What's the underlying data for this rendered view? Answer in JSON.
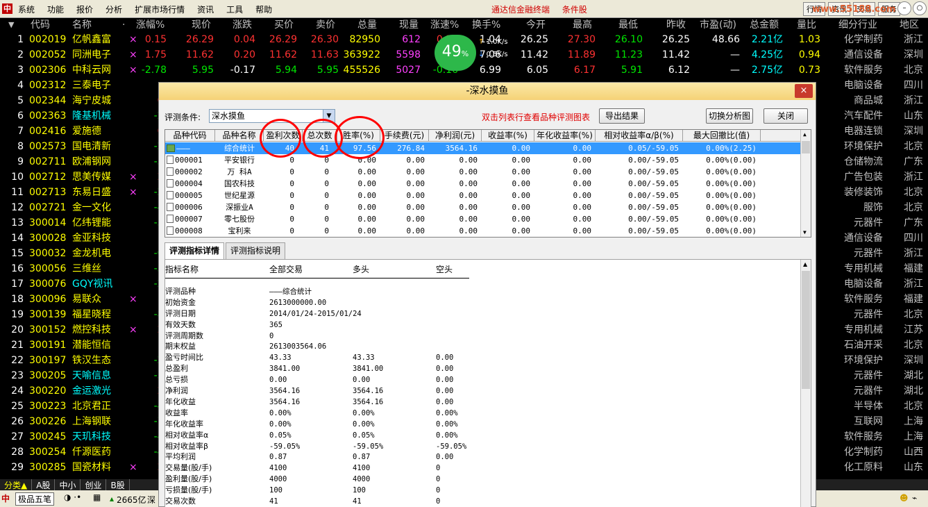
{
  "menubar": {
    "logo": "中",
    "menus": [
      "系统",
      "功能",
      "报价",
      "分析",
      "扩展市场行情",
      "资讯",
      "工具",
      "帮助"
    ],
    "center_links": [
      "通达信金融终端",
      "条件股"
    ],
    "right_buttons": [
      "行情",
      "资讯",
      "交易",
      "服务"
    ],
    "watermark": "www.55188.com"
  },
  "table": {
    "headers": [
      "代码",
      "名称",
      "·",
      "涨幅%",
      "现价",
      "涨跌",
      "买价",
      "卖价",
      "总量",
      "现量",
      "涨速%",
      "换手%",
      "今开",
      "最高",
      "最低",
      "昨收",
      "市盈(动)",
      "总金额",
      "量比",
      "细分行业",
      "地区"
    ],
    "rows": [
      {
        "n": "1",
        "code": "002019",
        "name": "亿帆鑫富",
        "mark": "×",
        "pct": "0.15",
        "price": "26.29",
        "chg": "0.04",
        "bid": "26.29",
        "ask": "26.30",
        "vol": "82950",
        "cur": "612",
        "spd": "0.11",
        "turn": "1.04",
        "open": "26.25",
        "high": "27.30",
        "low": "26.10",
        "prev": "26.25",
        "pe": "48.66",
        "amt": "2.21亿",
        "ratio": "1.03",
        "ind": "化学制药",
        "area": "浙江",
        "nc": "yellow",
        "dir": "up"
      },
      {
        "n": "2",
        "code": "002052",
        "name": "同洲电子",
        "mark": "×",
        "pct": "1.75",
        "price": "11.62",
        "chg": "0.20",
        "bid": "11.62",
        "ask": "11.63",
        "vol": "363922",
        "cur": "5598",
        "spd": "0.09",
        "turn": "7.06",
        "open": "11.42",
        "high": "11.89",
        "low": "11.23",
        "prev": "11.42",
        "pe": "—",
        "amt": "4.25亿",
        "ratio": "0.94",
        "ind": "通信设备",
        "area": "深圳",
        "nc": "yellow",
        "dir": "up"
      },
      {
        "n": "3",
        "code": "002306",
        "name": "中科云网",
        "mark": "×",
        "pct": "-2.78",
        "price": "5.95",
        "chg": "-0.17",
        "bid": "5.94",
        "ask": "5.95",
        "vol": "455526",
        "cur": "5027",
        "spd": "-0.16",
        "turn": "6.99",
        "open": "6.05",
        "high": "6.17",
        "low": "5.91",
        "prev": "6.12",
        "pe": "—",
        "amt": "2.75亿",
        "ratio": "0.73",
        "ind": "软件服务",
        "area": "北京",
        "nc": "yellow",
        "dir": "down"
      },
      {
        "n": "4",
        "code": "002312",
        "name": "三泰电子",
        "ind": "电脑设备",
        "area": "四川",
        "nc": "yellow",
        "dir": "none"
      },
      {
        "n": "5",
        "code": "002344",
        "name": "海宁皮城",
        "pct": "0.",
        "ind": "商品城",
        "area": "浙江",
        "nc": "yellow",
        "dir": "up"
      },
      {
        "n": "6",
        "code": "002363",
        "name": "隆基机械",
        "pct": "-2.",
        "ind": "汽车配件",
        "area": "山东",
        "nc": "cyan",
        "dir": "down"
      },
      {
        "n": "7",
        "code": "002416",
        "name": "爱施德",
        "pct": "0.",
        "ind": "电器连锁",
        "area": "深圳",
        "nc": "yellow",
        "dir": "up"
      },
      {
        "n": "8",
        "code": "002573",
        "name": "国电清新",
        "pct": "-2.",
        "ind": "环境保护",
        "area": "北京",
        "nc": "yellow",
        "dir": "down"
      },
      {
        "n": "9",
        "code": "002711",
        "name": "欧浦钢网",
        "pct": "-5.",
        "ind": "仓储物流",
        "area": "广东",
        "nc": "yellow",
        "dir": "down"
      },
      {
        "n": "10",
        "code": "002712",
        "name": "思美传媒",
        "mark": "×",
        "pct": "2.",
        "ind": "广告包装",
        "area": "浙江",
        "nc": "yellow",
        "dir": "up"
      },
      {
        "n": "11",
        "code": "002713",
        "name": "东易日盛",
        "mark": "×",
        "pct": "-2.",
        "ind": "装修装饰",
        "area": "北京",
        "nc": "yellow",
        "dir": "down"
      },
      {
        "n": "12",
        "code": "002721",
        "name": "金一文化",
        "pct": "-4.",
        "ind": "服饰",
        "area": "北京",
        "nc": "yellow",
        "dir": "down"
      },
      {
        "n": "13",
        "code": "300014",
        "name": "亿纬锂能",
        "pct": "-3.",
        "ind": "元器件",
        "area": "广东",
        "nc": "yellow",
        "dir": "down"
      },
      {
        "n": "14",
        "code": "300028",
        "name": "金亚科技",
        "ind": "通信设备",
        "area": "四川",
        "nc": "yellow",
        "dir": "none"
      },
      {
        "n": "15",
        "code": "300032",
        "name": "金龙机电",
        "pct": "-0.",
        "ind": "元器件",
        "area": "浙江",
        "nc": "yellow",
        "dir": "down"
      },
      {
        "n": "16",
        "code": "300056",
        "name": "三维丝",
        "pct": "-5.",
        "ind": "专用机械",
        "area": "福建",
        "nc": "yellow",
        "dir": "down"
      },
      {
        "n": "17",
        "code": "300076",
        "name": "GQY视讯",
        "pct": "-2.",
        "ind": "电脑设备",
        "area": "浙江",
        "nc": "cyan",
        "dir": "down"
      },
      {
        "n": "18",
        "code": "300096",
        "name": "易联众",
        "mark": "×",
        "pct": "1.",
        "ind": "软件服务",
        "area": "福建",
        "nc": "yellow",
        "dir": "up"
      },
      {
        "n": "19",
        "code": "300139",
        "name": "福星晓程",
        "pct": "-8.",
        "ind": "元器件",
        "area": "北京",
        "nc": "yellow",
        "dir": "down"
      },
      {
        "n": "20",
        "code": "300152",
        "name": "燃控科技",
        "mark": "×",
        "pct": "2.",
        "ind": "专用机械",
        "area": "江苏",
        "nc": "yellow",
        "dir": "up"
      },
      {
        "n": "21",
        "code": "300191",
        "name": "潜能恒信",
        "pct": "1.",
        "ind": "石油开采",
        "area": "北京",
        "nc": "yellow",
        "dir": "up"
      },
      {
        "n": "22",
        "code": "300197",
        "name": "铁汉生态",
        "pct": "-2.",
        "ind": "环境保护",
        "area": "深圳",
        "nc": "yellow",
        "dir": "down"
      },
      {
        "n": "23",
        "code": "300205",
        "name": "天喻信息",
        "pct": "-3.",
        "ind": "元器件",
        "area": "湖北",
        "nc": "cyan",
        "dir": "down"
      },
      {
        "n": "24",
        "code": "300220",
        "name": "金运激光",
        "pct": "2.",
        "ind": "元器件",
        "area": "湖北",
        "nc": "cyan",
        "dir": "up"
      },
      {
        "n": "25",
        "code": "300223",
        "name": "北京君正",
        "pct": "-4.",
        "ind": "半导体",
        "area": "北京",
        "nc": "yellow",
        "dir": "down"
      },
      {
        "n": "26",
        "code": "300226",
        "name": "上海钢联",
        "pct": "-7.",
        "ind": "互联网",
        "area": "上海",
        "nc": "yellow",
        "dir": "down"
      },
      {
        "n": "27",
        "code": "300245",
        "name": "天玑科技",
        "pct": "-4.",
        "ind": "软件服务",
        "area": "上海",
        "nc": "cyan",
        "dir": "down"
      },
      {
        "n": "28",
        "code": "300254",
        "name": "仟源医药",
        "pct": "-4.",
        "ind": "化学制药",
        "area": "山西",
        "nc": "yellow",
        "dir": "down"
      },
      {
        "n": "29",
        "code": "300285",
        "name": "国瓷材料",
        "mark": "×",
        "pct": "2.",
        "ind": "化工原料",
        "area": "山东",
        "nc": "yellow",
        "dir": "up"
      }
    ]
  },
  "speed_widget": {
    "value": "49",
    "unit": "%",
    "up": "1.0K/s",
    "down": "0.5K/s"
  },
  "bottom_tabs": [
    "分类▲",
    "A股",
    "中小",
    "创业",
    "B股"
  ],
  "statusbar": {
    "ime": "极品五笔",
    "amount": "2665亿",
    "market": "深"
  },
  "dialog": {
    "title": "-深水摸鱼",
    "close": "×",
    "condition_label": "评测条件:",
    "condition_value": "深水摸鱼",
    "hint": "双击列表行查看品种评测图表",
    "export_button": "导出结果",
    "switch_button": "切换分析图",
    "close_button": "关闭",
    "grid_headers": [
      "品种代码",
      "品种名称",
      "盈利次数",
      "总次数",
      "胜率(%)",
      "手续费(元)",
      "净利润(元)",
      "收益率(%)",
      "年化收益率(%)",
      "相对收益率α/β(%)",
      "最大回撤比(值)"
    ],
    "grid_rows": [
      {
        "code": "———",
        "name": "综合统计",
        "win": "40",
        "total": "41",
        "rate": "97.56",
        "fee": "276.84",
        "profit": "3564.16",
        "ret": "0.00",
        "annual": "0.00",
        "rel": "0.05/-59.05",
        "dd": "0.00%(2.25)",
        "sel": true
      },
      {
        "code": "000001",
        "name": "平安银行",
        "win": "0",
        "total": "0",
        "rate": "0.00",
        "fee": "0.00",
        "profit": "0.00",
        "ret": "0.00",
        "annual": "0.00",
        "rel": "0.00/-59.05",
        "dd": "0.00%(0.00)"
      },
      {
        "code": "000002",
        "name": "万 科A",
        "win": "0",
        "total": "0",
        "rate": "0.00",
        "fee": "0.00",
        "profit": "0.00",
        "ret": "0.00",
        "annual": "0.00",
        "rel": "0.00/-59.05",
        "dd": "0.00%(0.00)"
      },
      {
        "code": "000004",
        "name": "国农科技",
        "win": "0",
        "total": "0",
        "rate": "0.00",
        "fee": "0.00",
        "profit": "0.00",
        "ret": "0.00",
        "annual": "0.00",
        "rel": "0.00/-59.05",
        "dd": "0.00%(0.00)"
      },
      {
        "code": "000005",
        "name": "世纪星源",
        "win": "0",
        "total": "0",
        "rate": "0.00",
        "fee": "0.00",
        "profit": "0.00",
        "ret": "0.00",
        "annual": "0.00",
        "rel": "0.00/-59.05",
        "dd": "0.00%(0.00)"
      },
      {
        "code": "000006",
        "name": "深振业A",
        "win": "0",
        "total": "0",
        "rate": "0.00",
        "fee": "0.00",
        "profit": "0.00",
        "ret": "0.00",
        "annual": "0.00",
        "rel": "0.00/-59.05",
        "dd": "0.00%(0.00)"
      },
      {
        "code": "000007",
        "name": "零七股份",
        "win": "0",
        "total": "0",
        "rate": "0.00",
        "fee": "0.00",
        "profit": "0.00",
        "ret": "0.00",
        "annual": "0.00",
        "rel": "0.00/-59.05",
        "dd": "0.00%(0.00)"
      },
      {
        "code": "000008",
        "name": "宝利来",
        "win": "0",
        "total": "0",
        "rate": "0.00",
        "fee": "0.00",
        "profit": "0.00",
        "ret": "0.00",
        "annual": "0.00",
        "rel": "0.00/-59.05",
        "dd": "0.00%(0.00)"
      }
    ],
    "tabs": [
      "评测指标详情",
      "评测指标说明"
    ],
    "detail_headers": [
      "指标名称",
      "全部交易",
      "多头",
      "空头"
    ],
    "detail_rows": [
      {
        "label": "",
        "all": "",
        "long": "",
        "short": ""
      },
      {
        "label": "评测品种",
        "all": "———综合统计",
        "long": "",
        "short": ""
      },
      {
        "label": "初始资金",
        "all": "2613000000.00",
        "long": "",
        "short": ""
      },
      {
        "label": "评测日期",
        "all": "2014/01/24-2015/01/24",
        "long": "",
        "short": ""
      },
      {
        "label": "有效天数",
        "all": "365",
        "long": "",
        "short": ""
      },
      {
        "label": "评测周期数",
        "all": "0",
        "long": "",
        "short": ""
      },
      {
        "label": "期末权益",
        "all": "2613003564.06",
        "long": "",
        "short": ""
      },
      {
        "label": "盈亏时间比",
        "all": "43.33",
        "long": "43.33",
        "short": "0.00"
      },
      {
        "label": "总盈利",
        "all": "3841.00",
        "long": "3841.00",
        "short": "0.00"
      },
      {
        "label": "总亏损",
        "all": "0.00",
        "long": "0.00",
        "short": "0.00"
      },
      {
        "label": "净利润",
        "all": "3564.16",
        "long": "3564.16",
        "short": "0.00"
      },
      {
        "label": "年化收益",
        "all": "3564.16",
        "long": "3564.16",
        "short": "0.00"
      },
      {
        "label": "收益率",
        "all": "0.00%",
        "long": "0.00%",
        "short": "0.00%"
      },
      {
        "label": "年化收益率",
        "all": "0.00%",
        "long": "0.00%",
        "short": "0.00%"
      },
      {
        "label": "相对收益率α",
        "all": "0.05%",
        "long": "0.05%",
        "short": "0.00%"
      },
      {
        "label": "相对收益率β",
        "all": "-59.05%",
        "long": "-59.05%",
        "short": "-59.05%"
      },
      {
        "label": "平均利润",
        "all": "0.87",
        "long": "0.87",
        "short": "0.00"
      },
      {
        "label": "交易量(股/手)",
        "all": "4100",
        "long": "4100",
        "short": "0"
      },
      {
        "label": "盈利量(股/手)",
        "all": "4000",
        "long": "4000",
        "short": "0"
      },
      {
        "label": "亏损量(股/手)",
        "all": "100",
        "long": "100",
        "short": "0"
      },
      {
        "label": "交易次数",
        "all": "41",
        "long": "41",
        "short": "0"
      }
    ]
  }
}
